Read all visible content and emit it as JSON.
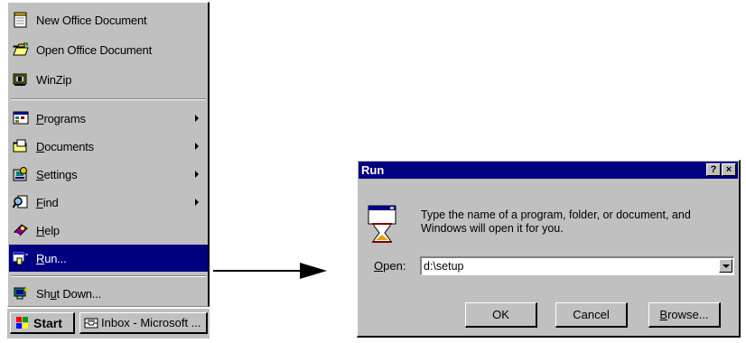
{
  "start_menu": {
    "top_items": [
      {
        "label": "New Office Document",
        "icon": "new-document-icon"
      },
      {
        "label": "Open Office Document",
        "icon": "open-folder-icon"
      },
      {
        "label": "WinZip",
        "icon": "winzip-icon"
      }
    ],
    "programs": {
      "pre": "",
      "ul": "P",
      "post": "rograms",
      "has_submenu": true,
      "icon": "programs-icon"
    },
    "documents": {
      "pre": "",
      "ul": "D",
      "post": "ocuments",
      "has_submenu": true,
      "icon": "documents-icon"
    },
    "settings": {
      "pre": "",
      "ul": "S",
      "post": "ettings",
      "has_submenu": true,
      "icon": "settings-icon"
    },
    "find": {
      "pre": "",
      "ul": "F",
      "post": "ind",
      "has_submenu": true,
      "icon": "find-icon"
    },
    "help": {
      "pre": "",
      "ul": "H",
      "post": "elp",
      "has_submenu": false,
      "icon": "help-icon"
    },
    "run": {
      "pre": "",
      "ul": "R",
      "post": "un...",
      "has_submenu": false,
      "selected": true,
      "icon": "run-icon"
    },
    "shutdown": {
      "pre": "Sh",
      "ul": "u",
      "post": "t Down...",
      "has_submenu": false,
      "icon": "shutdown-icon"
    }
  },
  "taskbar": {
    "start_label": "Start",
    "task_label": "Inbox - Microsoft ..."
  },
  "run_dialog": {
    "title": "Run",
    "help_label": "?",
    "close_label": "×",
    "description": "Type the name of a program, folder, or document, and Windows will open it for you.",
    "open_label_ul": "O",
    "open_label_rest": "pen:",
    "open_value": "d:\\setup",
    "ok_label": "OK",
    "cancel_label": "Cancel",
    "browse_ul": "B",
    "browse_rest": "rowse..."
  },
  "colors": {
    "face": "#c0c0c0",
    "selection": "#000080",
    "titlebar": "#000080"
  }
}
